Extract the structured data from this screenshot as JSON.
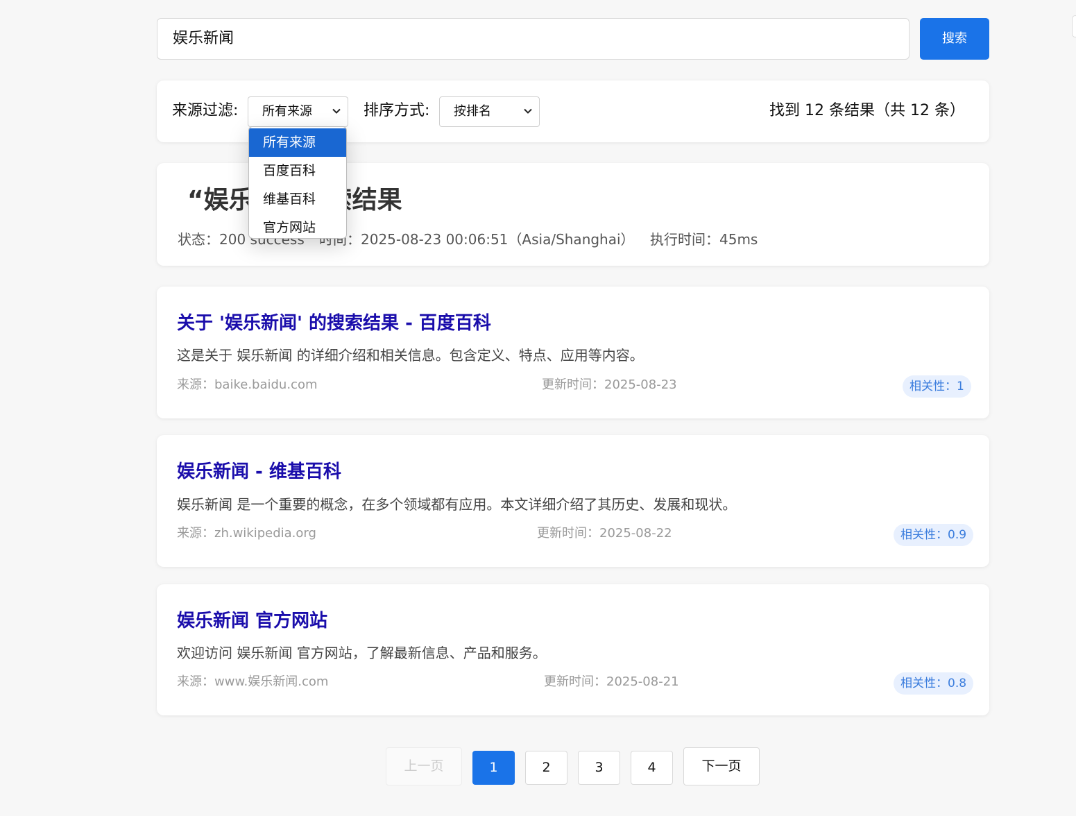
{
  "search": {
    "query": "娱乐新闻",
    "button_label": "搜索"
  },
  "filters": {
    "source_label": "来源过滤:",
    "source_selected": "所有来源",
    "sort_label": "排序方式:",
    "sort_selected": "按排名",
    "result_count": "找到 12 条结果（共 12 条）"
  },
  "source_dropdown": {
    "options": [
      "所有来源",
      "百度百科",
      "维基百科",
      "官方网站"
    ],
    "highlighted": "所有来源"
  },
  "header": {
    "title_visible_left": "“娱乐",
    "title_visible_right": "搜索结果",
    "status_text": "状态：200 success",
    "time_text": "时间：2025-08-23 00:06:51（Asia/Shanghai）",
    "exec_time_text": "执行时间：45ms"
  },
  "results": [
    {
      "title": "关于 '娱乐新闻' 的搜索结果 - 百度百科",
      "description": "这是关于 娱乐新闻 的详细介绍和相关信息。包含定义、特点、应用等内容。",
      "source": "来源：baike.baidu.com",
      "updated": "更新时间：2025-08-23",
      "relevance": "相关性：1"
    },
    {
      "title": "娱乐新闻 - 维基百科",
      "description": "娱乐新闻 是一个重要的概念，在多个领域都有应用。本文详细介绍了其历史、发展和现状。",
      "source": "来源：zh.wikipedia.org",
      "updated": "更新时间：2025-08-22",
      "relevance": "相关性：0.9"
    },
    {
      "title": "娱乐新闻 官方网站",
      "description": "欢迎访问 娱乐新闻 官方网站，了解最新信息、产品和服务。",
      "source": "来源：www.娱乐新闻.com",
      "updated": "更新时间：2025-08-21",
      "relevance": "相关性：0.8"
    }
  ],
  "pagination": {
    "prev_label": "上一页",
    "pages": [
      "1",
      "2",
      "3",
      "4"
    ],
    "current": "1",
    "next_label": "下一页"
  },
  "colors": {
    "accent": "#1a73e8",
    "link": "#1a0dab",
    "badge_bg": "#e8f0fe",
    "badge_text": "#3b7ddd",
    "page_bg": "#f7f7f7"
  }
}
